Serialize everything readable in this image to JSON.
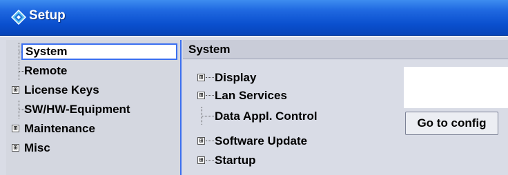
{
  "window": {
    "title": "Setup",
    "icon": "rohde-schwarz-diamond-icon"
  },
  "tree": {
    "items": [
      {
        "label": "System",
        "expandable": false,
        "selected": true
      },
      {
        "label": "Remote",
        "expandable": false,
        "selected": false
      },
      {
        "label": "License Keys",
        "expandable": true,
        "selected": false
      },
      {
        "label": "SW/HW-Equipment",
        "expandable": false,
        "selected": false
      },
      {
        "label": "Maintenance",
        "expandable": true,
        "selected": false
      },
      {
        "label": "Misc",
        "expandable": true,
        "selected": false
      }
    ]
  },
  "content": {
    "header": "System",
    "items": [
      {
        "label": "Display",
        "expandable": true
      },
      {
        "label": "Lan Services",
        "expandable": true
      },
      {
        "label": "Data Appl. Control",
        "expandable": false
      },
      {
        "label": "Software Update",
        "expandable": true
      },
      {
        "label": "Startup",
        "expandable": true
      }
    ],
    "go_button_label": "Go to config"
  },
  "icons": {
    "expand": "⊞"
  }
}
